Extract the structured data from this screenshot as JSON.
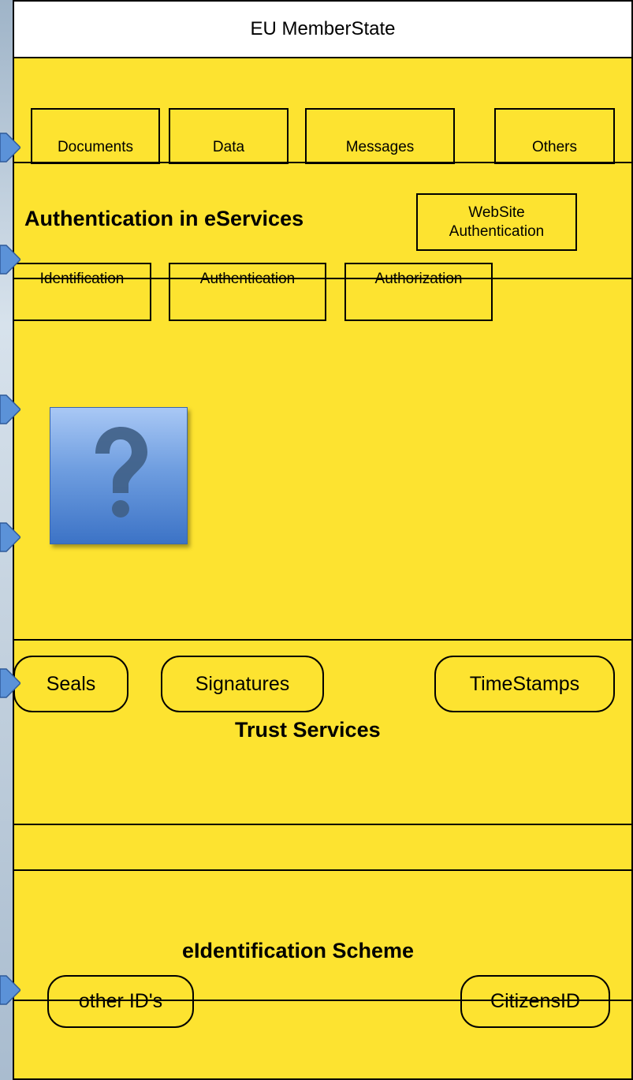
{
  "header": {
    "title": "EU MemberState"
  },
  "eservices": {
    "heading": "Authentication in eServices",
    "items": [
      "Documents",
      "Data",
      "Messages",
      "Others"
    ],
    "website_auth": "WebSite\nAuthentication",
    "auth_steps": [
      "Identification",
      "Authentication",
      "Authorization"
    ],
    "icon": "question-mark-icon"
  },
  "trust_services": {
    "heading": "Trust Services",
    "items": [
      "Seals",
      "Signatures",
      "TimeStamps"
    ]
  },
  "eid_scheme": {
    "heading": "eIdentification Scheme",
    "items": [
      "other ID's",
      "CitizensID"
    ]
  },
  "colors": {
    "panel": "#fde330",
    "border": "#000000",
    "icon_blue": "#4a7fcf",
    "arrow_blue": "#5b92d8"
  }
}
